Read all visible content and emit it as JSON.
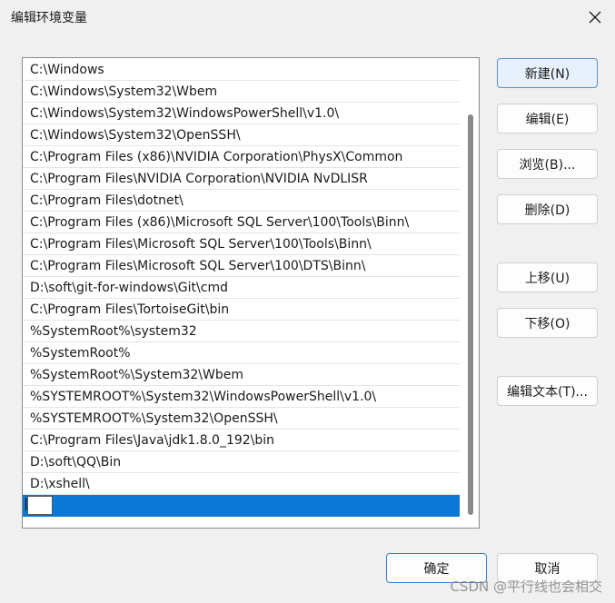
{
  "window": {
    "title": "编辑环境变量",
    "close_icon": "close-icon"
  },
  "path_list": {
    "items": [
      "C:\\Windows",
      "C:\\Windows\\System32\\Wbem",
      "C:\\Windows\\System32\\WindowsPowerShell\\v1.0\\",
      "C:\\Windows\\System32\\OpenSSH\\",
      "C:\\Program Files (x86)\\NVIDIA Corporation\\PhysX\\Common",
      "C:\\Program Files\\NVIDIA Corporation\\NVIDIA NvDLISR",
      "C:\\Program Files\\dotnet\\",
      "C:\\Program Files (x86)\\Microsoft SQL Server\\100\\Tools\\Binn\\",
      "C:\\Program Files\\Microsoft SQL Server\\100\\Tools\\Binn\\",
      "C:\\Program Files\\Microsoft SQL Server\\100\\DTS\\Binn\\",
      "D:\\soft\\git-for-windows\\Git\\cmd",
      "C:\\Program Files\\TortoiseGit\\bin",
      "%SystemRoot%\\system32",
      "%SystemRoot%",
      "%SystemRoot%\\System32\\Wbem",
      "%SYSTEMROOT%\\System32\\WindowsPowerShell\\v1.0\\",
      "%SYSTEMROOT%\\System32\\OpenSSH\\",
      "C:\\Program Files\\Java\\jdk1.8.0_192\\bin",
      "D:\\soft\\QQ\\Bin",
      "D:\\xshell\\"
    ],
    "editing_value": ""
  },
  "buttons": {
    "new": "新建(N)",
    "edit": "编辑(E)",
    "browse": "浏览(B)...",
    "delete": "删除(D)",
    "move_up": "上移(U)",
    "move_down": "下移(O)",
    "edit_text": "编辑文本(T)...",
    "ok": "确定",
    "cancel": "取消"
  },
  "watermark": "CSDN @平行线也会相交",
  "colors": {
    "selection": "#0a78d4",
    "dialog_bg": "#f0f0f0",
    "primary_border": "#5b8fcf"
  }
}
